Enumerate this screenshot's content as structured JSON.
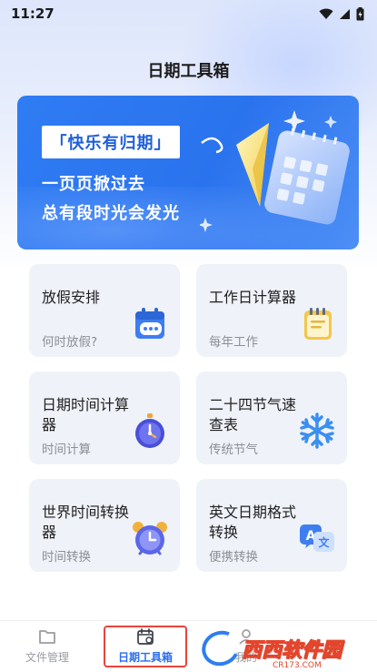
{
  "status_bar": {
    "time": "11:27"
  },
  "header": {
    "title": "日期工具箱"
  },
  "banner": {
    "tag": "「快乐有归期」",
    "line1": "一页页掀过去",
    "line2": "总有段时光会发光"
  },
  "tools": [
    {
      "title": "放假安排",
      "subtitle": "何时放假?",
      "icon": "calendar-chat-icon"
    },
    {
      "title": "工作日计算器",
      "subtitle": "每年工作",
      "icon": "notepad-icon"
    },
    {
      "title": "日期时间计算器",
      "subtitle": "时间计算",
      "icon": "stopwatch-icon"
    },
    {
      "title": "二十四节气速查表",
      "subtitle": "传统节气",
      "icon": "snowflake-icon"
    },
    {
      "title": "世界时间转换器",
      "subtitle": "时间转换",
      "icon": "alarm-clock-icon"
    },
    {
      "title": "英文日期格式转换",
      "subtitle": "便携转换",
      "icon": "translate-icon"
    }
  ],
  "bottom_nav": {
    "items": [
      {
        "label": "文件管理",
        "icon": "folder-icon",
        "active": false
      },
      {
        "label": "日期工具箱",
        "icon": "calendar-tool-icon",
        "active": true
      },
      {
        "label": "我的",
        "icon": "user-icon",
        "active": false
      }
    ]
  },
  "watermark": {
    "text": "西西软件园",
    "sub": "CR173.COM"
  },
  "colors": {
    "accent": "#2f7cf3",
    "active_nav": "#2a6ef0",
    "inactive_nav": "#9a9ca3",
    "card_bg": "#eff2f8",
    "highlight": "#e8453c"
  }
}
